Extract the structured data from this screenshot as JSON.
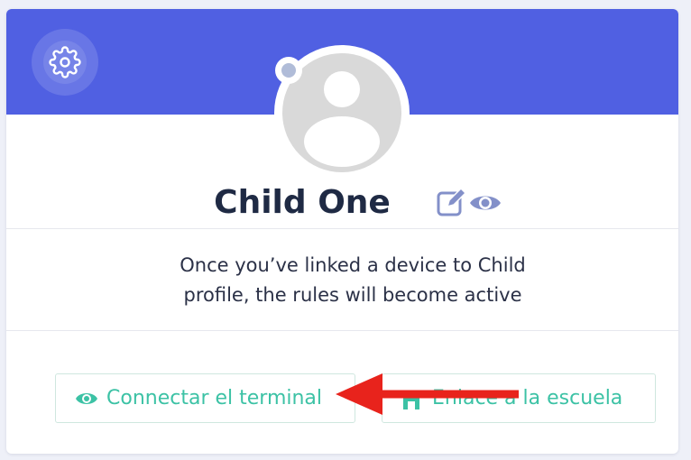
{
  "profile": {
    "name": "Child One",
    "message_line1": "Once you’ve linked a device to Child",
    "message_line2": "profile, the rules will become active"
  },
  "icons": {
    "settings": "gear-icon",
    "edit": "edit-icon",
    "view": "eye-icon",
    "connect": "eye-icon",
    "school": "school-icon",
    "avatar": "user-avatar-placeholder"
  },
  "actions": {
    "connect_label": "Connectar el terminal",
    "school_label": "Enlace a la escuela"
  },
  "colors": {
    "banner": "#5060e2",
    "accent": "#3cc2a5",
    "icon_muted": "#8390c9",
    "annotation_arrow": "#e8231c"
  }
}
